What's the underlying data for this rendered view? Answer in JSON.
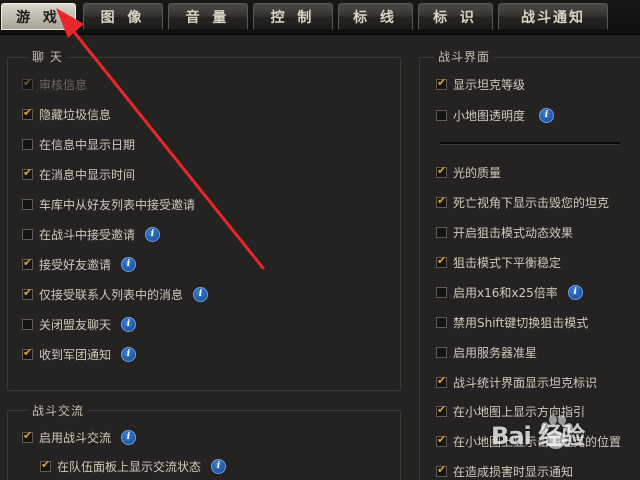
{
  "tabs": [
    {
      "label": "游 戏",
      "active": true
    },
    {
      "label": "图 像",
      "active": false
    },
    {
      "label": "音 量",
      "active": false
    },
    {
      "label": "控 制",
      "active": false
    },
    {
      "label": "标 线",
      "active": false
    },
    {
      "label": "标 识",
      "active": false
    },
    {
      "label": "战斗通知",
      "active": false
    }
  ],
  "chat": {
    "title": "聊 天",
    "options": [
      {
        "label": "审核信息",
        "checked": true,
        "disabled": true,
        "info": false
      },
      {
        "label": "隐藏垃圾信息",
        "checked": true,
        "disabled": false,
        "info": false
      },
      {
        "label": "在信息中显示日期",
        "checked": false,
        "disabled": false,
        "info": false
      },
      {
        "label": "在消息中显示时间",
        "checked": true,
        "disabled": false,
        "info": false
      },
      {
        "label": "车库中从好友列表中接受邀请",
        "checked": false,
        "disabled": false,
        "info": false
      },
      {
        "label": "在战斗中接受邀请",
        "checked": false,
        "disabled": false,
        "info": true
      },
      {
        "label": "接受好友邀请",
        "checked": true,
        "disabled": false,
        "info": true
      },
      {
        "label": "仅接受联系人列表中的消息",
        "checked": true,
        "disabled": false,
        "info": true
      },
      {
        "label": "关闭盟友聊天",
        "checked": false,
        "disabled": false,
        "info": true
      },
      {
        "label": "收到军团通知",
        "checked": true,
        "disabled": false,
        "info": true
      }
    ]
  },
  "battle_comm": {
    "title": "战斗交流",
    "options": [
      {
        "label": "启用战斗交流",
        "checked": true,
        "disabled": false,
        "info": true,
        "indent": false
      },
      {
        "label": "在队伍面板上显示交流状态",
        "checked": true,
        "disabled": false,
        "info": true,
        "indent": true
      }
    ]
  },
  "battle_ui": {
    "title": "战斗界面",
    "options_top": [
      {
        "label": "显示坦克等级",
        "checked": true,
        "info": false
      },
      {
        "label": "小地图透明度",
        "checked": false,
        "info": true
      }
    ],
    "options": [
      {
        "label": "光的质量",
        "checked": true,
        "info": false
      },
      {
        "label": "死亡视角下显示击毁您的坦克",
        "checked": true,
        "info": false
      },
      {
        "label": "开启狙击模式动态效果",
        "checked": false,
        "info": false
      },
      {
        "label": "狙击模式下平衡稳定",
        "checked": true,
        "info": false
      },
      {
        "label": "启用x16和x25倍率",
        "checked": false,
        "info": true
      },
      {
        "label": "禁用Shift键切换狙击模式",
        "checked": false,
        "info": false
      },
      {
        "label": "启用服务器准星",
        "checked": false,
        "info": false
      },
      {
        "label": "战斗统计界面显示坦克标识",
        "checked": true,
        "info": false
      },
      {
        "label": "在小地图上显示方向指引",
        "checked": true,
        "info": false
      },
      {
        "label": "在小地图上显示击毁坦克的位置",
        "checked": true,
        "info": false
      },
      {
        "label": "在造成损害时显示通知",
        "checked": true,
        "info": false
      }
    ]
  },
  "info_glyph": "i",
  "watermark": "Bai 经验",
  "colors": {
    "check_mark": "#e0a033",
    "info_icon": "#1f5db4",
    "arrow": "#e8262d"
  }
}
